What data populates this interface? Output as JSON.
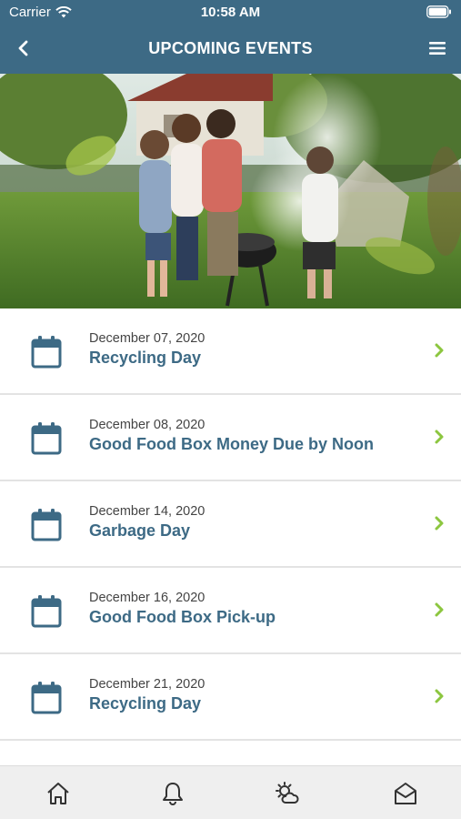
{
  "status_bar": {
    "carrier": "Carrier",
    "time": "10:58 AM"
  },
  "nav": {
    "title": "UPCOMING EVENTS",
    "back_icon": "chevron-left-icon",
    "menu_icon": "hamburger-menu-icon"
  },
  "colors": {
    "primary": "#3d6a85",
    "accent_chevron": "#8cc63f",
    "divider": "#e3e3e3",
    "tab_bar_bg": "#efefef"
  },
  "events": [
    {
      "date": "December 07, 2020",
      "title": "Recycling Day"
    },
    {
      "date": "December 08, 2020",
      "title": "Good Food Box Money Due by Noon"
    },
    {
      "date": "December 14, 2020",
      "title": "Garbage Day"
    },
    {
      "date": "December 16, 2020",
      "title": "Good Food Box Pick-up"
    },
    {
      "date": "December 21, 2020",
      "title": "Recycling Day"
    }
  ],
  "tab_bar": {
    "icons": [
      "home-icon",
      "bell-icon",
      "weather-icon",
      "mail-icon"
    ]
  }
}
